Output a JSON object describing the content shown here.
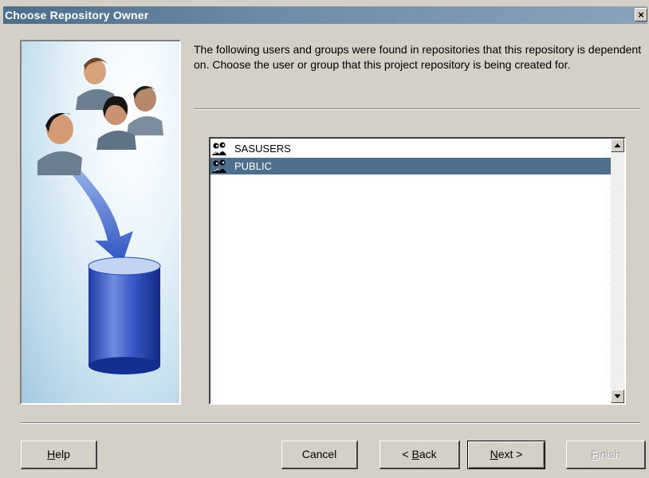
{
  "window": {
    "title": "Choose Repository Owner",
    "close_label": "×"
  },
  "description": "The following users and groups were found in repositories that this repository is dependent on. Choose the user or group that this project repository is being created for.",
  "owner_list": {
    "items": [
      {
        "label": "SASUSERS",
        "icon": "group-icon",
        "selected": false
      },
      {
        "label": "PUBLIC",
        "icon": "group-icon",
        "selected": true
      }
    ],
    "selection_color": "#4e6f8e"
  },
  "buttons": {
    "help": {
      "prefix": "",
      "hotkey": "H",
      "suffix": "elp"
    },
    "cancel": {
      "label": "Cancel"
    },
    "back": {
      "prefix": "< ",
      "hotkey": "B",
      "suffix": "ack"
    },
    "next": {
      "prefix": "",
      "hotkey": "N",
      "suffix": "ext >"
    },
    "finish": {
      "prefix": "",
      "hotkey": "F",
      "suffix": "inish",
      "disabled": true
    }
  },
  "colors": {
    "title_bar": "#6d8aa6",
    "dialog_bg": "#d4d0c8"
  }
}
